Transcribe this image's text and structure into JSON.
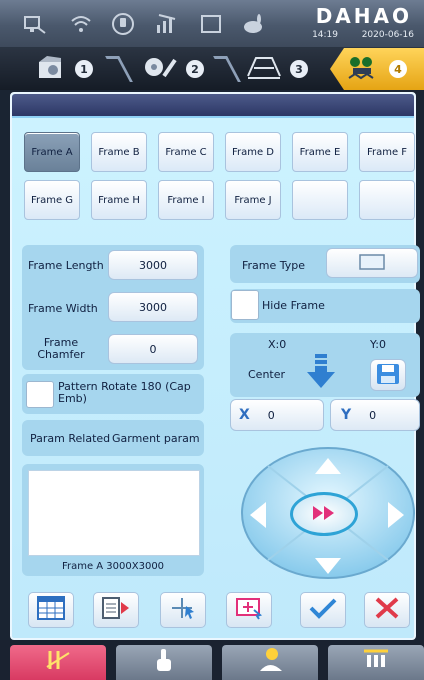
{
  "status_bar": {
    "icons": [
      "network-icon",
      "wifi-icon",
      "usb-icon",
      "signal-icon",
      "window-icon",
      "rabbit-icon"
    ],
    "brand": "DAHAO",
    "time": "14:19",
    "date": "2020-06-16"
  },
  "steps": [
    {
      "num": "1",
      "icon": "frame-pattern-icon"
    },
    {
      "num": "2",
      "icon": "flower-edit-icon"
    },
    {
      "num": "3",
      "icon": "frame-measure-icon"
    },
    {
      "num": "4",
      "icon": "frame-settings-icon",
      "active": true
    }
  ],
  "frames": {
    "row1": [
      "Frame A",
      "Frame B",
      "Frame C",
      "Frame D",
      "Frame E",
      "Frame F"
    ],
    "row2": [
      "Frame G",
      "Frame H",
      "Frame I",
      "Frame J",
      "",
      ""
    ],
    "selected": "Frame A"
  },
  "params": {
    "frame_length_label": "Frame Length",
    "frame_length_value": "3000",
    "frame_width_label": "Frame Width",
    "frame_width_value": "3000",
    "frame_chamfer_label": "Frame Chamfer",
    "frame_chamfer_value": "0",
    "pattern_rotate_label": "Pattern Rotate 180 (Cap Emb)",
    "param_related_label": "Param Related",
    "param_related_value": "Garment param"
  },
  "right": {
    "frame_type_label": "Frame Type",
    "hide_frame_label": "Hide Frame",
    "x_label": "X:0",
    "y_label": "Y:0",
    "center_label": "Center",
    "x_coord_label": "X",
    "x_coord_value": "0",
    "y_coord_label": "Y",
    "y_coord_value": "0"
  },
  "preview": {
    "caption": "Frame A 3000X3000"
  },
  "toolbar": [
    "table-icon",
    "import-icon",
    "move-point-icon",
    "add-frame-icon",
    "confirm-icon",
    "cancel-icon"
  ],
  "bottom_nav": [
    "needle-icon",
    "hand-icon",
    "person-icon",
    "thread-icon"
  ]
}
